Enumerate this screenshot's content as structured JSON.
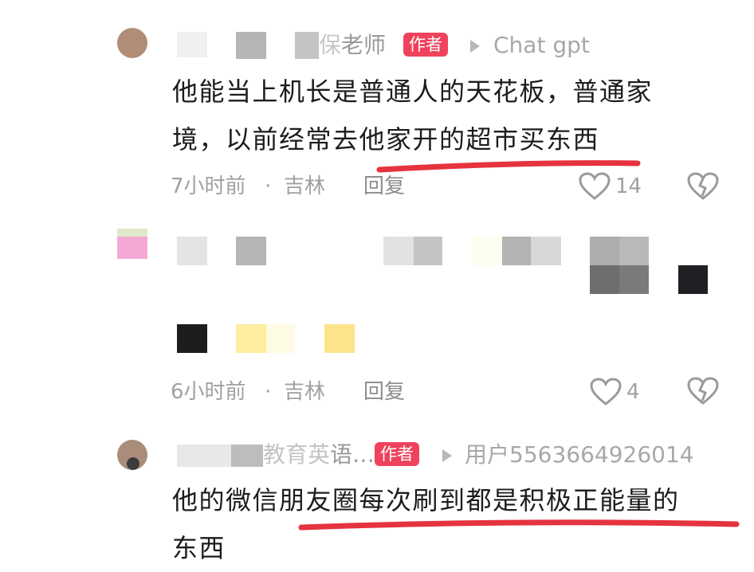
{
  "comments": [
    {
      "user_name": "老师",
      "user_name_prefix": "保",
      "author_badge": "作者",
      "reply_to": "Chat gpt",
      "content_line1": "他能当上机长是普通人的天花板，普通家",
      "content_line2": "境，以前经常去他家开的超市买东西",
      "time": "7小时前",
      "separator": "·",
      "location": "吉林",
      "reply_label": "回复",
      "like_count": "14"
    },
    {
      "time": "6小时前",
      "separator": "·",
      "location": "吉林",
      "reply_label": "回复",
      "like_count": "4"
    },
    {
      "user_name": "语…",
      "user_name_prefix": "教育英",
      "author_badge": "作者",
      "reply_to": "用户5563664926014",
      "content_line1": "他的微信朋友圈每次刷到都是积极正能量的",
      "content_line2": "东西"
    }
  ],
  "icons": {
    "like": "heart-outline-icon",
    "dislike": "broken-heart-icon",
    "reply_arrow": "triangle-right-icon"
  },
  "colors": {
    "badge": "#f0425d",
    "underline": "#e5333f",
    "meta_text": "#a0a0a0"
  }
}
